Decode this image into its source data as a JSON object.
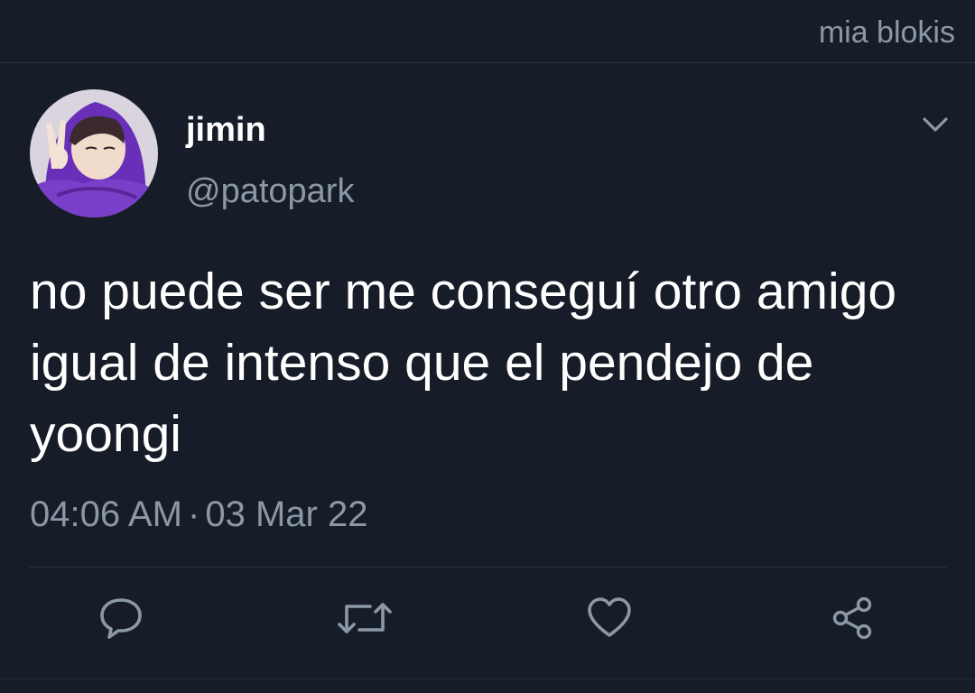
{
  "topbar": {
    "label": "mia blokis"
  },
  "tweet": {
    "display_name": "jimin",
    "handle": "@patopark",
    "text": "no puede ser me conseguí otro amigo igual de intenso que el pendejo de yoongi",
    "time": "04:06 AM",
    "separator": "·",
    "date": "03 Mar 22"
  },
  "icons": {
    "menu": "chevron-down-icon",
    "reply": "reply-icon",
    "retweet": "retweet-icon",
    "like": "heart-icon",
    "share": "share-icon"
  },
  "colors": {
    "background": "#161d28",
    "text_primary": "#ffffff",
    "text_secondary": "#8b98a5",
    "divider": "#2c3540",
    "avatar_purple": "#7a3fc8"
  }
}
